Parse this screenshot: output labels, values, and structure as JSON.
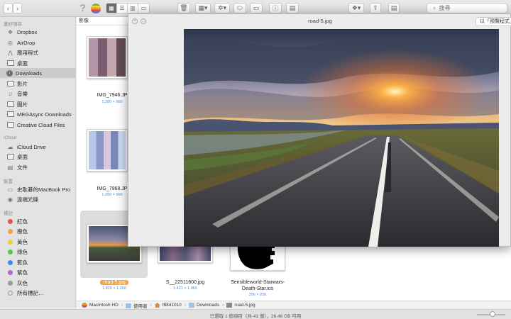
{
  "toolbar": {
    "help_glyph": "?",
    "search_placeholder": "搜尋"
  },
  "sidebar": {
    "favorites_heading": "喜好項目",
    "favorites": [
      {
        "label": "Dropbox",
        "icon": "dropbox-icon"
      },
      {
        "label": "AirDrop",
        "icon": "airdrop-icon"
      },
      {
        "label": "應用程式",
        "icon": "applications-icon"
      },
      {
        "label": "桌面",
        "icon": "desktop-icon"
      },
      {
        "label": "Downloads",
        "icon": "downloads-icon",
        "selected": true
      },
      {
        "label": "影片",
        "icon": "movies-icon"
      },
      {
        "label": "音樂",
        "icon": "music-icon"
      },
      {
        "label": "圖片",
        "icon": "pictures-icon"
      },
      {
        "label": "MEGAsync Downloads",
        "icon": "folder-icon"
      },
      {
        "label": "Creative Cloud Files",
        "icon": "folder-icon"
      }
    ],
    "icloud_heading": "iCloud",
    "icloud": [
      {
        "label": "iCloud Drive",
        "icon": "icloud-icon"
      },
      {
        "label": "桌面",
        "icon": "desktop-icon"
      },
      {
        "label": "文件",
        "icon": "documents-icon"
      }
    ],
    "devices_heading": "裝置",
    "devices": [
      {
        "label": "史耿碁的MacBook Pro",
        "icon": "laptop-icon"
      },
      {
        "label": "遠端光碟",
        "icon": "disc-icon"
      }
    ],
    "tags_heading": "標記",
    "tags": [
      {
        "label": "紅色",
        "color": "#f0524b"
      },
      {
        "label": "橙色",
        "color": "#f5a23c"
      },
      {
        "label": "黃色",
        "color": "#f3cf3c"
      },
      {
        "label": "綠色",
        "color": "#5dc24f"
      },
      {
        "label": "藍色",
        "color": "#3c8df3"
      },
      {
        "label": "紫色",
        "color": "#b865d4"
      },
      {
        "label": "灰色",
        "color": "#9b9b9b"
      }
    ],
    "all_tags": "所有標記…"
  },
  "main": {
    "section_header": "影像",
    "files": [
      {
        "name": "IMG_7946.JP",
        "dims": "1,280 × 960"
      },
      {
        "name": "IMG_7968.JP",
        "dims": "1,280 × 960"
      },
      {
        "name": "road-5.jpg",
        "dims": "1,820 × 1,260",
        "selected": true
      },
      {
        "name": "S__22511800.jpg",
        "dims": "1,421 × 1,065"
      },
      {
        "name": "Sensibleworld-Starwars-",
        "name2": "Death-Star.ico",
        "dims": "256 × 256"
      }
    ]
  },
  "pathbar": {
    "items": [
      "Macintosh HD",
      "使用者",
      "f8841010",
      "Downloads",
      "road-5.jpg"
    ]
  },
  "statusbar": {
    "text": "已選取 1 個項目（共 41 個），26.46 GB 可用"
  },
  "quicklook": {
    "title": "road-5.jpg",
    "open_with": "以「預覽程式」打開"
  },
  "colors": {
    "accent_blue": "#4b8fe0",
    "selection_orange": "#f5a23c"
  }
}
